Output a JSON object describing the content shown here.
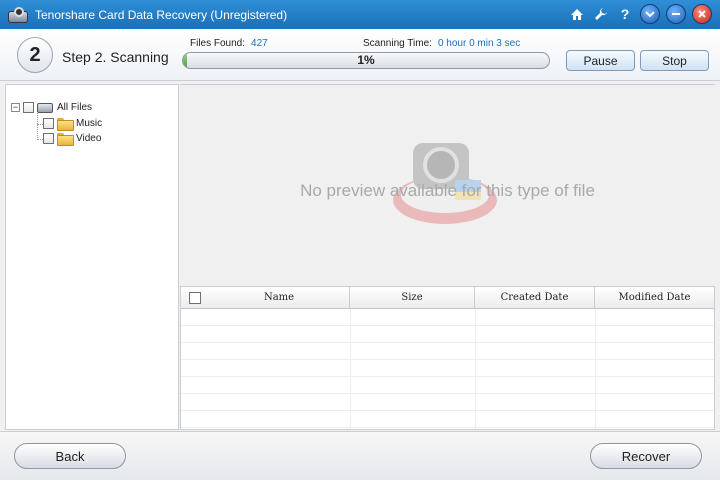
{
  "window": {
    "title": "Tenorshare Card Data Recovery (Unregistered)",
    "icons": [
      "home-icon",
      "wrench-icon",
      "help-icon"
    ],
    "controls": [
      "feedback-icon",
      "minimize-icon",
      "close-icon"
    ]
  },
  "header": {
    "step_number": "2",
    "step_title": "Step 2. Scanning",
    "files_found_label": "Files Found:",
    "files_found_value": "427",
    "scan_time_label": "Scanning Time:",
    "scan_time_value": "0 hour 0 min 3 sec",
    "progress_text": "1%",
    "progress_fraction": 0.01,
    "pause_label": "Pause",
    "stop_label": "Stop"
  },
  "tree": {
    "root_label": "All Files",
    "children": [
      {
        "label": "Music"
      },
      {
        "label": "Video"
      }
    ]
  },
  "preview": {
    "message": "No preview available for this type of file"
  },
  "table": {
    "columns": [
      "Name",
      "Size",
      "Created Date",
      "Modified Date"
    ]
  },
  "footer": {
    "back_label": "Back",
    "recover_label": "Recover"
  }
}
